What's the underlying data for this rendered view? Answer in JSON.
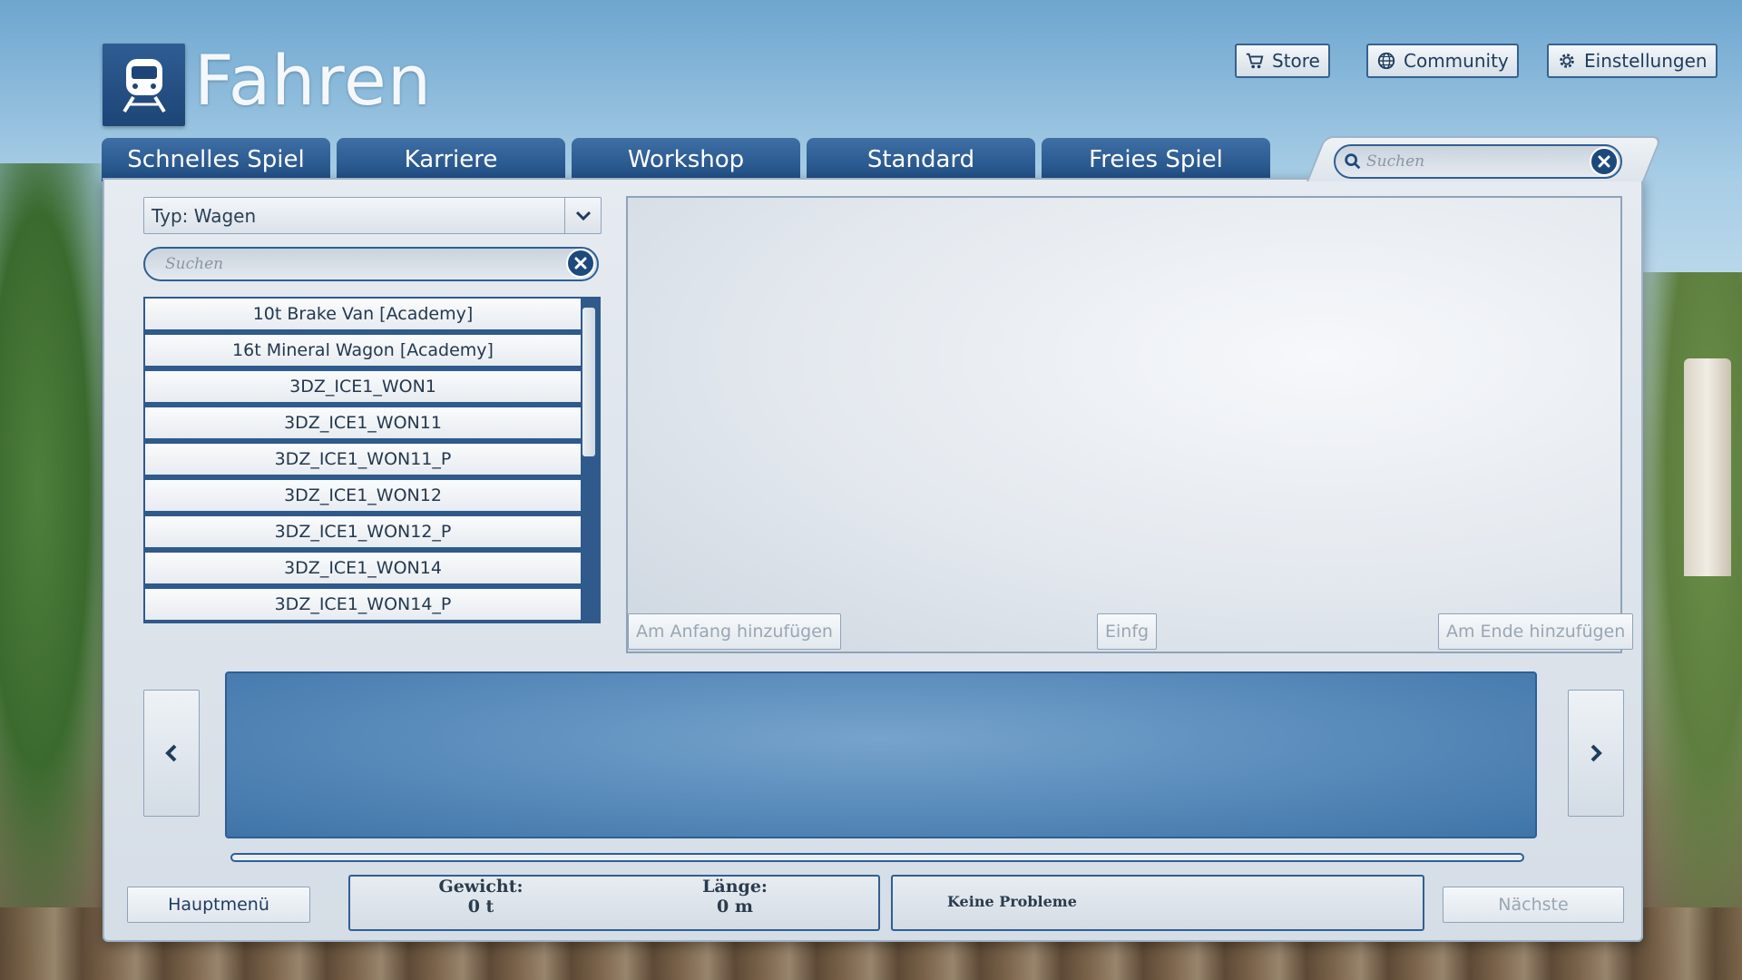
{
  "header": {
    "title": "Fahren",
    "logo_icon": "train-icon",
    "buttons": [
      {
        "label": "Store",
        "icon": "cart-icon"
      },
      {
        "label": "Community",
        "icon": "globe-icon"
      },
      {
        "label": "Einstellungen",
        "icon": "gear-icon"
      }
    ]
  },
  "tabs": [
    {
      "label": "Schnelles Spiel"
    },
    {
      "label": "Karriere"
    },
    {
      "label": "Workshop"
    },
    {
      "label": "Standard"
    },
    {
      "label": "Freies Spiel"
    }
  ],
  "top_search": {
    "placeholder": "Suchen"
  },
  "filter": {
    "type_label": "Typ: Wagen",
    "search_placeholder": "Suchen"
  },
  "list": {
    "items": [
      "10t Brake Van [Academy]",
      "16t Mineral Wagon [Academy]",
      "3DZ_ICE1_WON1",
      "3DZ_ICE1_WON11",
      "3DZ_ICE1_WON11_P",
      "3DZ_ICE1_WON12",
      "3DZ_ICE1_WON12_P",
      "3DZ_ICE1_WON14",
      "3DZ_ICE1_WON14_P"
    ]
  },
  "preview": {
    "add_start": "Am Anfang hinzufügen",
    "insert": "Einfg",
    "add_end": "Am Ende hinzufügen"
  },
  "footer": {
    "main_menu": "Hauptmenü",
    "weight_label": "Gewicht:",
    "weight_value": "0 t",
    "length_label": "Länge:",
    "length_value": "0 m",
    "status": "Keine Probleme",
    "next": "Nächste"
  },
  "colors": {
    "accent": "#1f4d82",
    "panel": "#dfe5ec",
    "consist": "#5a8cbb"
  }
}
